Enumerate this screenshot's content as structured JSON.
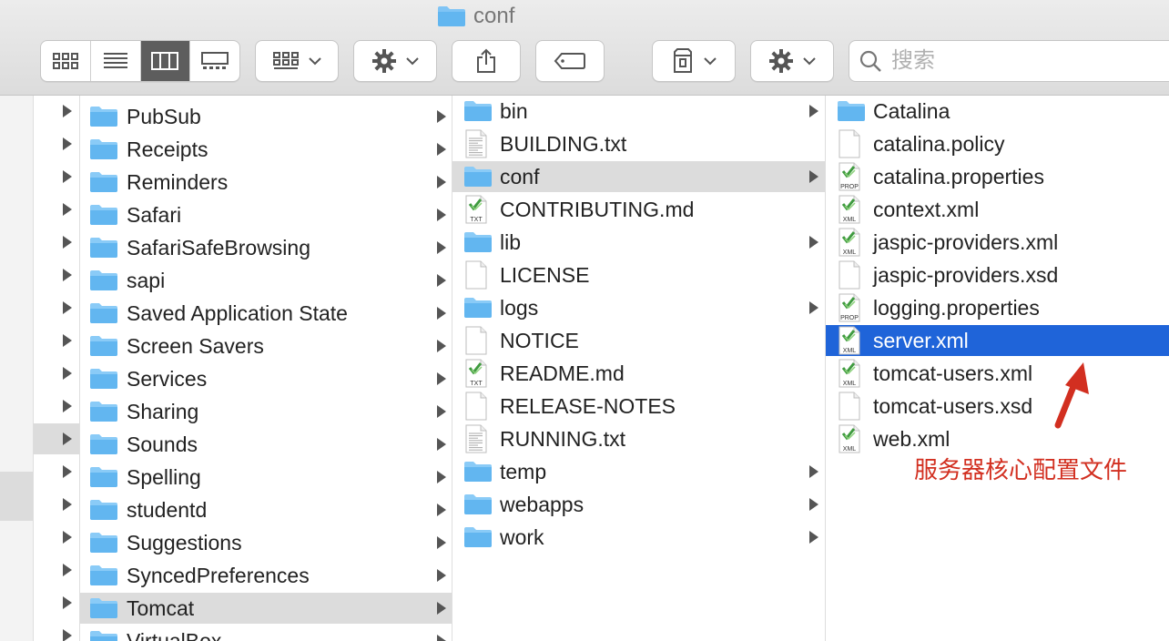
{
  "window": {
    "title": "conf"
  },
  "toolbar": {
    "view_buttons": [
      "icon-view-icon",
      "list-view-icon",
      "column-view-icon",
      "gallery-view-icon"
    ],
    "active_view": 2,
    "group_icon": "group-by-icon",
    "action_icon": "gear-icon",
    "share_icon": "share-icon",
    "tag_icon": "tag-icon",
    "archive_icon": "archive-icon",
    "action2_icon": "gear-icon"
  },
  "search": {
    "placeholder": "搜索"
  },
  "columns": {
    "col1": [
      {
        "label": "PubSub",
        "folder": true
      },
      {
        "label": "Receipts",
        "folder": true
      },
      {
        "label": "Reminders",
        "folder": true
      },
      {
        "label": "Safari",
        "folder": true
      },
      {
        "label": "SafariSafeBrowsing",
        "folder": true
      },
      {
        "label": "sapi",
        "folder": true
      },
      {
        "label": "Saved Application State",
        "folder": true
      },
      {
        "label": "Screen Savers",
        "folder": true
      },
      {
        "label": "Services",
        "folder": true
      },
      {
        "label": "Sharing",
        "folder": true
      },
      {
        "label": "Sounds",
        "folder": true
      },
      {
        "label": "Spelling",
        "folder": true
      },
      {
        "label": "studentd",
        "folder": true
      },
      {
        "label": "Suggestions",
        "folder": true
      },
      {
        "label": "SyncedPreferences",
        "folder": true
      },
      {
        "label": "Tomcat",
        "folder": true,
        "selected": true
      },
      {
        "label": "VirtualBox",
        "folder": true
      }
    ],
    "col2": [
      {
        "label": "bin",
        "type": "folder"
      },
      {
        "label": "BUILDING.txt",
        "type": "text"
      },
      {
        "label": "conf",
        "type": "folder",
        "selected": true
      },
      {
        "label": "CONTRIBUTING.md",
        "type": "txt-badge"
      },
      {
        "label": "lib",
        "type": "folder"
      },
      {
        "label": "LICENSE",
        "type": "blank"
      },
      {
        "label": "logs",
        "type": "folder"
      },
      {
        "label": "NOTICE",
        "type": "blank"
      },
      {
        "label": "README.md",
        "type": "txt-badge"
      },
      {
        "label": "RELEASE-NOTES",
        "type": "blank"
      },
      {
        "label": "RUNNING.txt",
        "type": "text"
      },
      {
        "label": "temp",
        "type": "folder"
      },
      {
        "label": "webapps",
        "type": "folder"
      },
      {
        "label": "work",
        "type": "folder"
      }
    ],
    "col3": [
      {
        "label": "Catalina",
        "type": "folder"
      },
      {
        "label": "catalina.policy",
        "type": "blank"
      },
      {
        "label": "catalina.properties",
        "type": "badge",
        "badge": "PROP"
      },
      {
        "label": "context.xml",
        "type": "badge",
        "badge": "XML"
      },
      {
        "label": "jaspic-providers.xml",
        "type": "badge",
        "badge": "XML"
      },
      {
        "label": "jaspic-providers.xsd",
        "type": "blank"
      },
      {
        "label": "logging.properties",
        "type": "badge",
        "badge": "PROP"
      },
      {
        "label": "server.xml",
        "type": "badge",
        "badge": "XML",
        "selected": true
      },
      {
        "label": "tomcat-users.xml",
        "type": "badge",
        "badge": "XML"
      },
      {
        "label": "tomcat-users.xsd",
        "type": "blank"
      },
      {
        "label": "web.xml",
        "type": "badge",
        "badge": "XML"
      }
    ]
  },
  "annotation": {
    "text": "服务器核心配置文件",
    "color": "#d22f20"
  },
  "colors": {
    "selection_blue": "#1f64d9",
    "selection_gray": "#dcdcdc",
    "folder": "#62b6f0"
  }
}
